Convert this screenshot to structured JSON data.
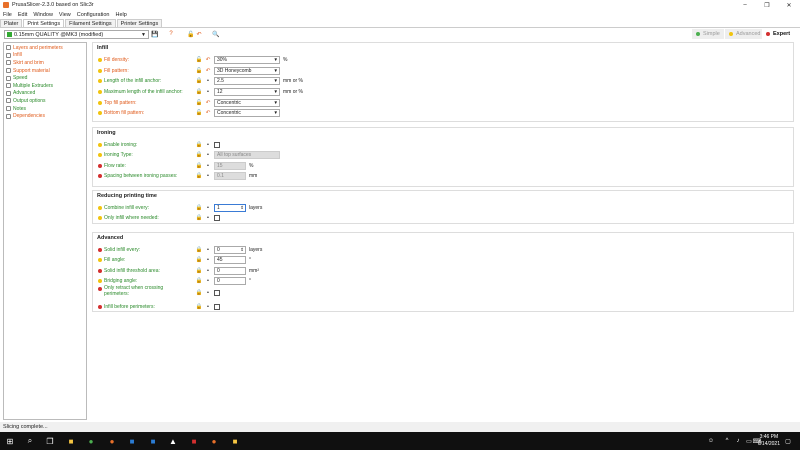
{
  "window": {
    "title": "PrusaSlicer-2.3.0 based on Slic3r",
    "controls": [
      "–",
      "❐",
      "✕"
    ]
  },
  "menu": [
    "File",
    "Edit",
    "Window",
    "View",
    "Configuration",
    "Help"
  ],
  "tabs": [
    "Plater",
    "Print Settings",
    "Filament Settings",
    "Printer Settings"
  ],
  "preset": {
    "value": "0.15mm QUALITY @MK3 (modified)"
  },
  "modes": {
    "simple": "Simple",
    "advanced": "Advanced",
    "expert": "Expert"
  },
  "sidebar": [
    {
      "label": "Layers and perimeters",
      "state": "orange"
    },
    {
      "label": "Infill",
      "state": "orange"
    },
    {
      "label": "Skirt and brim",
      "state": "orange"
    },
    {
      "label": "Support material",
      "state": "orange"
    },
    {
      "label": "Speed",
      "state": "green"
    },
    {
      "label": "Multiple Extruders",
      "state": "green"
    },
    {
      "label": "Advanced",
      "state": "green"
    },
    {
      "label": "Output options",
      "state": "green"
    },
    {
      "label": "Notes",
      "state": "green"
    },
    {
      "label": "Dependencies",
      "state": "orange"
    }
  ],
  "infill": {
    "title": "Infill",
    "fill_density": {
      "label": "Fill density:",
      "value": "30%",
      "unit": "%"
    },
    "fill_pattern": {
      "label": "Fill pattern:",
      "value": "3D Honeycomb"
    },
    "anchor_length": {
      "label": "Length of the infill anchor:",
      "value": "2.5",
      "unit": "mm or %"
    },
    "anchor_max": {
      "label": "Maximum length of the infill anchor:",
      "value": "12",
      "unit": "mm or %"
    },
    "top_pattern": {
      "label": "Top fill pattern:",
      "value": "Concentric"
    },
    "bottom_pattern": {
      "label": "Bottom fill pattern:",
      "value": "Concentric"
    }
  },
  "ironing": {
    "title": "Ironing",
    "enable": {
      "label": "Enable ironing:"
    },
    "type": {
      "label": "Ironing Type:",
      "value": "All top surfaces"
    },
    "flow": {
      "label": "Flow rate:",
      "value": "15",
      "unit": "%"
    },
    "spacing": {
      "label": "Spacing between ironing passes:",
      "value": "0.1",
      "unit": "mm"
    }
  },
  "reducing": {
    "title": "Reducing printing time",
    "combine": {
      "label": "Combine infill every:",
      "value": "1",
      "unit": "layers"
    },
    "only_needed": {
      "label": "Only infill where needed:"
    }
  },
  "advanced": {
    "title": "Advanced",
    "solid_every": {
      "label": "Solid infill every:",
      "value": "0",
      "unit": "layers"
    },
    "fill_angle": {
      "label": "Fill angle:",
      "value": "45",
      "unit": "°"
    },
    "solid_threshold": {
      "label": "Solid infill threshold area:",
      "value": "0",
      "unit": "mm²"
    },
    "bridging_angle": {
      "label": "Bridging angle:",
      "value": "0",
      "unit": "°"
    },
    "only_retract": {
      "label": "Only retract when crossing perimeters:"
    },
    "infill_first": {
      "label": "Infill before perimeters:"
    }
  },
  "status": "Slicing complete...",
  "clock": {
    "time": "3:46 PM",
    "date": "6/14/2021"
  },
  "colors": {
    "orange": "#e05a1a",
    "green": "#2a8a2a",
    "yellow": "#f1c40f",
    "red": "#d32f2f"
  }
}
